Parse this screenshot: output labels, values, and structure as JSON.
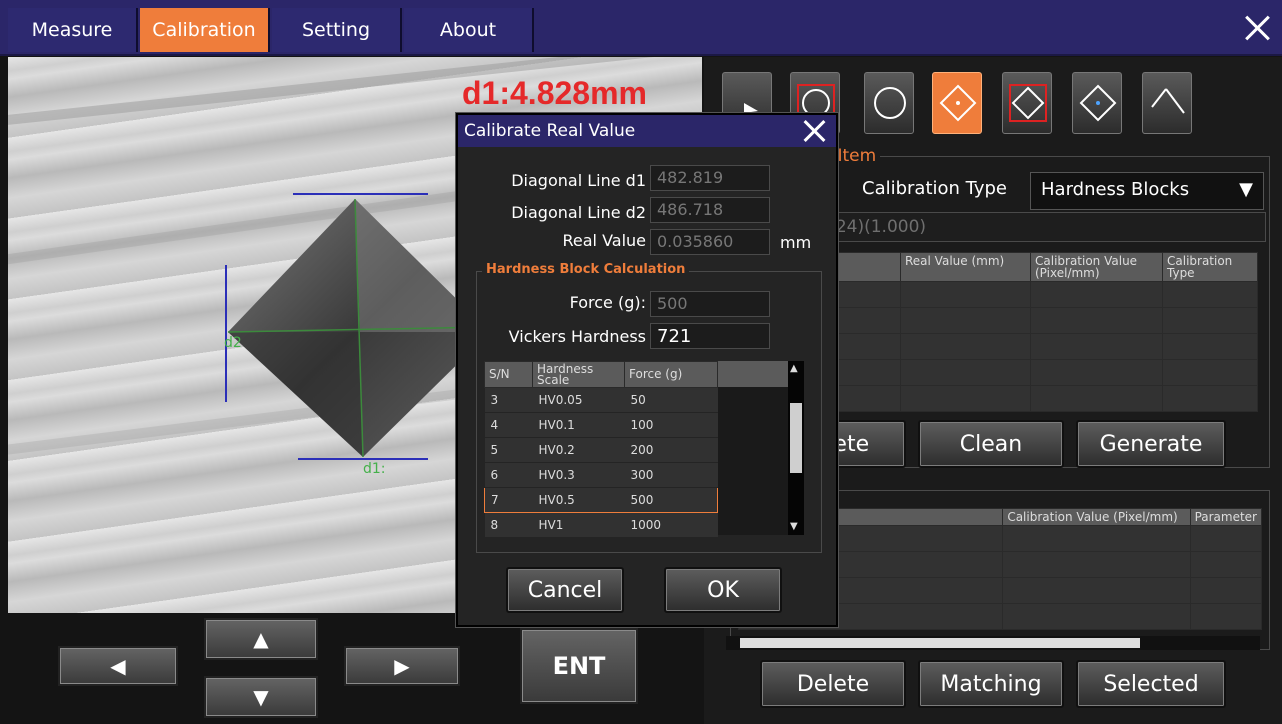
{
  "menu": {
    "items": [
      "Measure",
      "Calibration",
      "Setting",
      "About"
    ],
    "active": "Calibration"
  },
  "image": {
    "readout": "d1:4.828mm",
    "label_d1": "d1:",
    "label_d2": "d2"
  },
  "nav": {
    "left": "◀",
    "up": "▲",
    "down": "▼",
    "right": "▶",
    "ent": "ENT"
  },
  "measured": {
    "group_title": "Measured Item",
    "calibration_type_label": "Calibration Type",
    "calibration_type_value": "Hardness Blocks",
    "resolution_text": "(1280 * 1024)(1.000)",
    "columns": [
      "",
      "Real Value (mm)",
      "Calibration Value (Pixel/mm)",
      "Calibration Type"
    ],
    "buttons": {
      "delete": "Delete",
      "clean": "Clean",
      "generate": "Generate"
    }
  },
  "results": {
    "columns": [
      "",
      "Calibration Value (Pixel/mm)",
      "Parameter"
    ],
    "buttons": {
      "delete": "Delete",
      "matching": "Matching",
      "selected": "Selected"
    }
  },
  "dialog": {
    "title": "Calibrate Real Value",
    "d1_label": "Diagonal Line d1",
    "d1_value": "482.819",
    "d2_label": "Diagonal Line d2",
    "d2_value": "486.718",
    "real_label": "Real Value",
    "real_value": "0.035860",
    "real_unit": "mm",
    "group_title": "Hardness Block Calculation",
    "force_label": "Force (g):",
    "force_value": "500",
    "hardness_label": "Vickers Hardness",
    "hardness_value": "721",
    "table": {
      "headers": [
        "S/N",
        "Hardness Scale",
        "Force (g)"
      ],
      "rows": [
        [
          "3",
          "HV0.05",
          "50"
        ],
        [
          "4",
          "HV0.1",
          "100"
        ],
        [
          "5",
          "HV0.2",
          "200"
        ],
        [
          "6",
          "HV0.3",
          "300"
        ],
        [
          "7",
          "HV0.5",
          "500"
        ],
        [
          "8",
          "HV1",
          "1000"
        ]
      ],
      "selected_index": 4
    },
    "cancel": "Cancel",
    "ok": "OK"
  },
  "colors": {
    "accent": "#ef7d3b",
    "menubar": "#2b2669",
    "readout": "#e5292a",
    "measure_line": "#2b2fb8",
    "label_green": "#44b04a"
  }
}
